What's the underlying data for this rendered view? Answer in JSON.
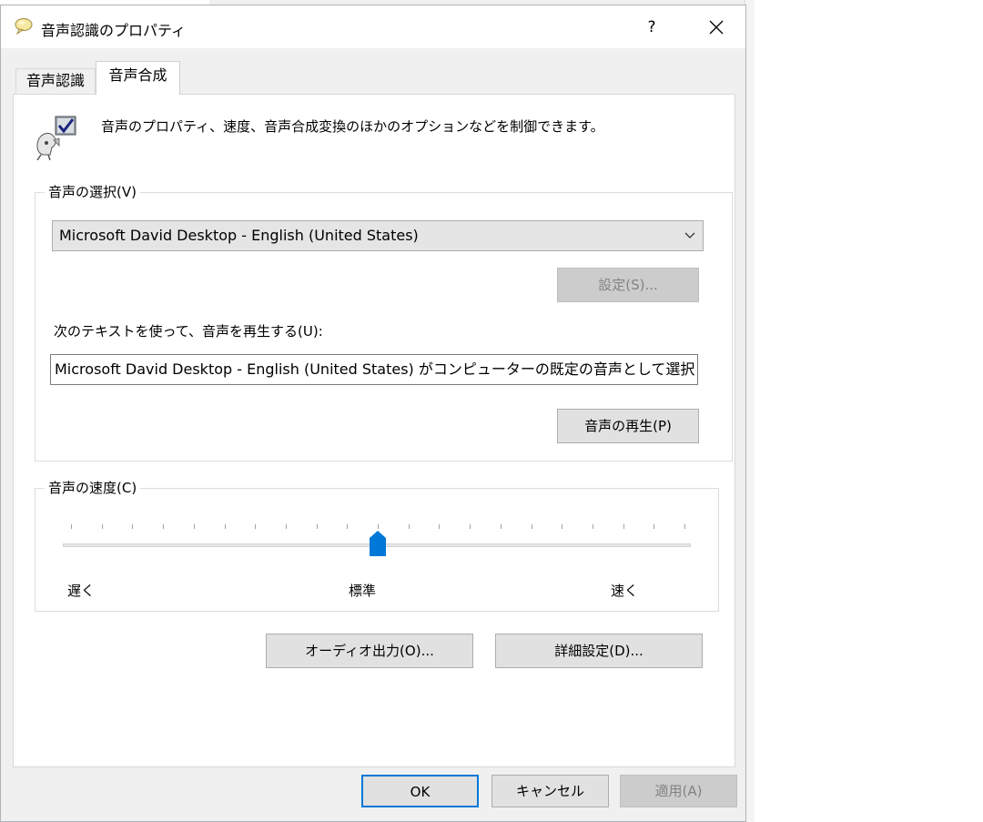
{
  "window": {
    "title": "音声認識のプロパティ",
    "help_glyph": "?",
    "close_glyph": "✕"
  },
  "tabs": [
    {
      "label": "音声認識",
      "active": false
    },
    {
      "label": "音声合成",
      "active": true
    }
  ],
  "description": "音声のプロパティ、速度、音声合成変換のほかのオプションなどを制御できます。",
  "voice_group": {
    "label": "音声の選択(V)",
    "selected_voice": "Microsoft David Desktop - English (United States)",
    "settings_button": "設定(S)...",
    "preview_label": "次のテキストを使って、音声を再生する(U):",
    "preview_text": "Microsoft David Desktop - English (United States) がコンピューターの既定の音声として選択されて",
    "play_button": "音声の再生(P)"
  },
  "speed_group": {
    "label": "音声の速度(C)",
    "slow_label": "遅く",
    "normal_label": "標準",
    "fast_label": "速く",
    "slider_value": 0.5
  },
  "audio_output_button": "オーディオ出力(O)...",
  "advanced_button": "詳細設定(D)...",
  "footer": {
    "ok": "OK",
    "cancel": "キャンセル",
    "apply": "適用(A)"
  },
  "colors": {
    "accent": "#0078d7",
    "dialog_bg": "#f0f0f0",
    "panel_bg": "#ffffff"
  },
  "icons": {
    "title": "speech-bubble-icon",
    "header": "speech-properties-icon",
    "combo": "chevron-down-icon",
    "close": "close-icon"
  }
}
